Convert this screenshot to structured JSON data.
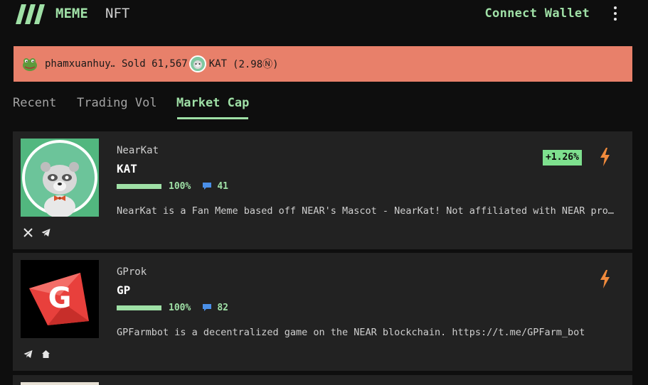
{
  "nav": {
    "meme_label": "MEME",
    "nft_label": "NFT",
    "connect_label": "Connect Wallet",
    "accent": "#9fe0a6"
  },
  "ticker": {
    "user": "phamxuanhuy…",
    "action": "Sold 61,567",
    "token": "KAT",
    "amount": "(2.98Ⓝ)",
    "background": "#e8806a"
  },
  "tabs": [
    {
      "label": "Recent",
      "active": false
    },
    {
      "label": "Trading Vol",
      "active": false
    },
    {
      "label": "Market Cap",
      "active": true
    }
  ],
  "cards": [
    {
      "name": "NearKat",
      "symbol": "KAT",
      "progress": "100%",
      "progress_fraction": 1.0,
      "comments": "41",
      "change": "+1.26%",
      "description": "NearKat is a Fan Meme based off NEAR's Mascot - NearKat! Not affiliated with NEAR protocol.",
      "socials": [
        "x-icon",
        "telegram-icon"
      ]
    },
    {
      "name": "GProk",
      "symbol": "GP",
      "progress": "100%",
      "progress_fraction": 1.0,
      "comments": "82",
      "description": "GPFarmbot is a decentralized game on the NEAR blockchain. https://t.me/GPFarm_bot",
      "socials": [
        "telegram-icon",
        "home-icon"
      ]
    }
  ]
}
